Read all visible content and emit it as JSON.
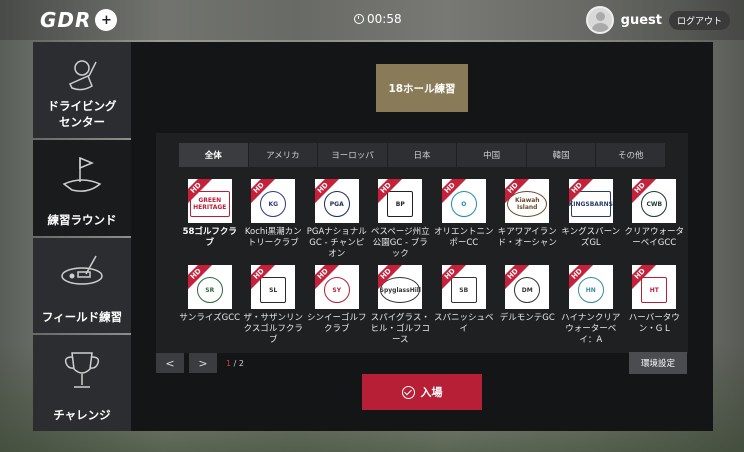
{
  "header": {
    "logo_text": "GDR",
    "logo_badge": "+",
    "timer": "00:58",
    "username": "guest",
    "logout_label": "ログアウト"
  },
  "sidebar": {
    "items": [
      {
        "label1": "ドライビング",
        "label2": "センター",
        "icon": "golf-club-icon",
        "active": false
      },
      {
        "label1": "練習ラウンド",
        "label2": "",
        "icon": "flag-green-icon",
        "active": true
      },
      {
        "label1": "フィールド練習",
        "label2": "",
        "icon": "putter-icon",
        "active": false
      },
      {
        "label1": "チャレンジ",
        "label2": "",
        "icon": "trophy-icon",
        "active": false
      }
    ]
  },
  "main": {
    "mode_label": "18ホール練習",
    "tabs": [
      "全体",
      "アメリカ",
      "ヨーロッパ",
      "日本",
      "中国",
      "韓国",
      "その他"
    ],
    "active_tab": 0,
    "hd_badge": "HD",
    "courses": [
      {
        "name": "58ゴルフクラブ",
        "logo": "GREEN HERITAGE",
        "color": "#b71f37",
        "bold": true
      },
      {
        "name": "Kochi黒潮カントリークラブ",
        "logo": "KG",
        "color": "#2a3a8a",
        "bold": false
      },
      {
        "name": "PGAナショナルGC - チャンピオン",
        "logo": "PGA",
        "color": "#1c2a5a",
        "bold": false
      },
      {
        "name": "ペスページ州立公園GC - ブラック",
        "logo": "BP",
        "color": "#222222",
        "bold": false
      },
      {
        "name": "オリエントニンポーCC",
        "logo": "O",
        "color": "#1d8fb0",
        "bold": false
      },
      {
        "name": "キアワアイランド・オーシャン",
        "logo": "Kiawah Island",
        "color": "#6a4a2a",
        "bold": false
      },
      {
        "name": "キングスバーンズGL",
        "logo": "KINGSBARNS",
        "color": "#2a3a6a",
        "bold": false
      },
      {
        "name": "クリアウォーターベイGCC",
        "logo": "CWB",
        "color": "#1a3a2a",
        "bold": false
      },
      {
        "name": "サンライズGCC",
        "logo": "SR",
        "color": "#2a6a3a",
        "bold": false
      },
      {
        "name": "ザ・サザンリンクスゴルフクラブ",
        "logo": "SL",
        "color": "#2a2a2a",
        "bold": false
      },
      {
        "name": "シンイーゴルフクラブ",
        "logo": "SY",
        "color": "#b71f37",
        "bold": false
      },
      {
        "name": "スパイグラス・ヒル・ゴルフコース",
        "logo": "SpyglassHill",
        "color": "#333333",
        "bold": false
      },
      {
        "name": "スパニッシュベイ",
        "logo": "SB",
        "color": "#333333",
        "bold": false
      },
      {
        "name": "デルモンテGC",
        "logo": "DM",
        "color": "#333333",
        "bold": false
      },
      {
        "name": "ハイナンクリアウォーターベイ：A",
        "logo": "HN",
        "color": "#3a8a9a",
        "bold": false
      },
      {
        "name": "ハーバータウン・G L",
        "logo": "HT",
        "color": "#b71f37",
        "bold": false
      }
    ]
  },
  "pager": {
    "prev": "<",
    "next": ">",
    "current": "1",
    "separator": " / ",
    "total": "2"
  },
  "buttons": {
    "settings_label": "環境設定",
    "enter_label": "入場"
  }
}
